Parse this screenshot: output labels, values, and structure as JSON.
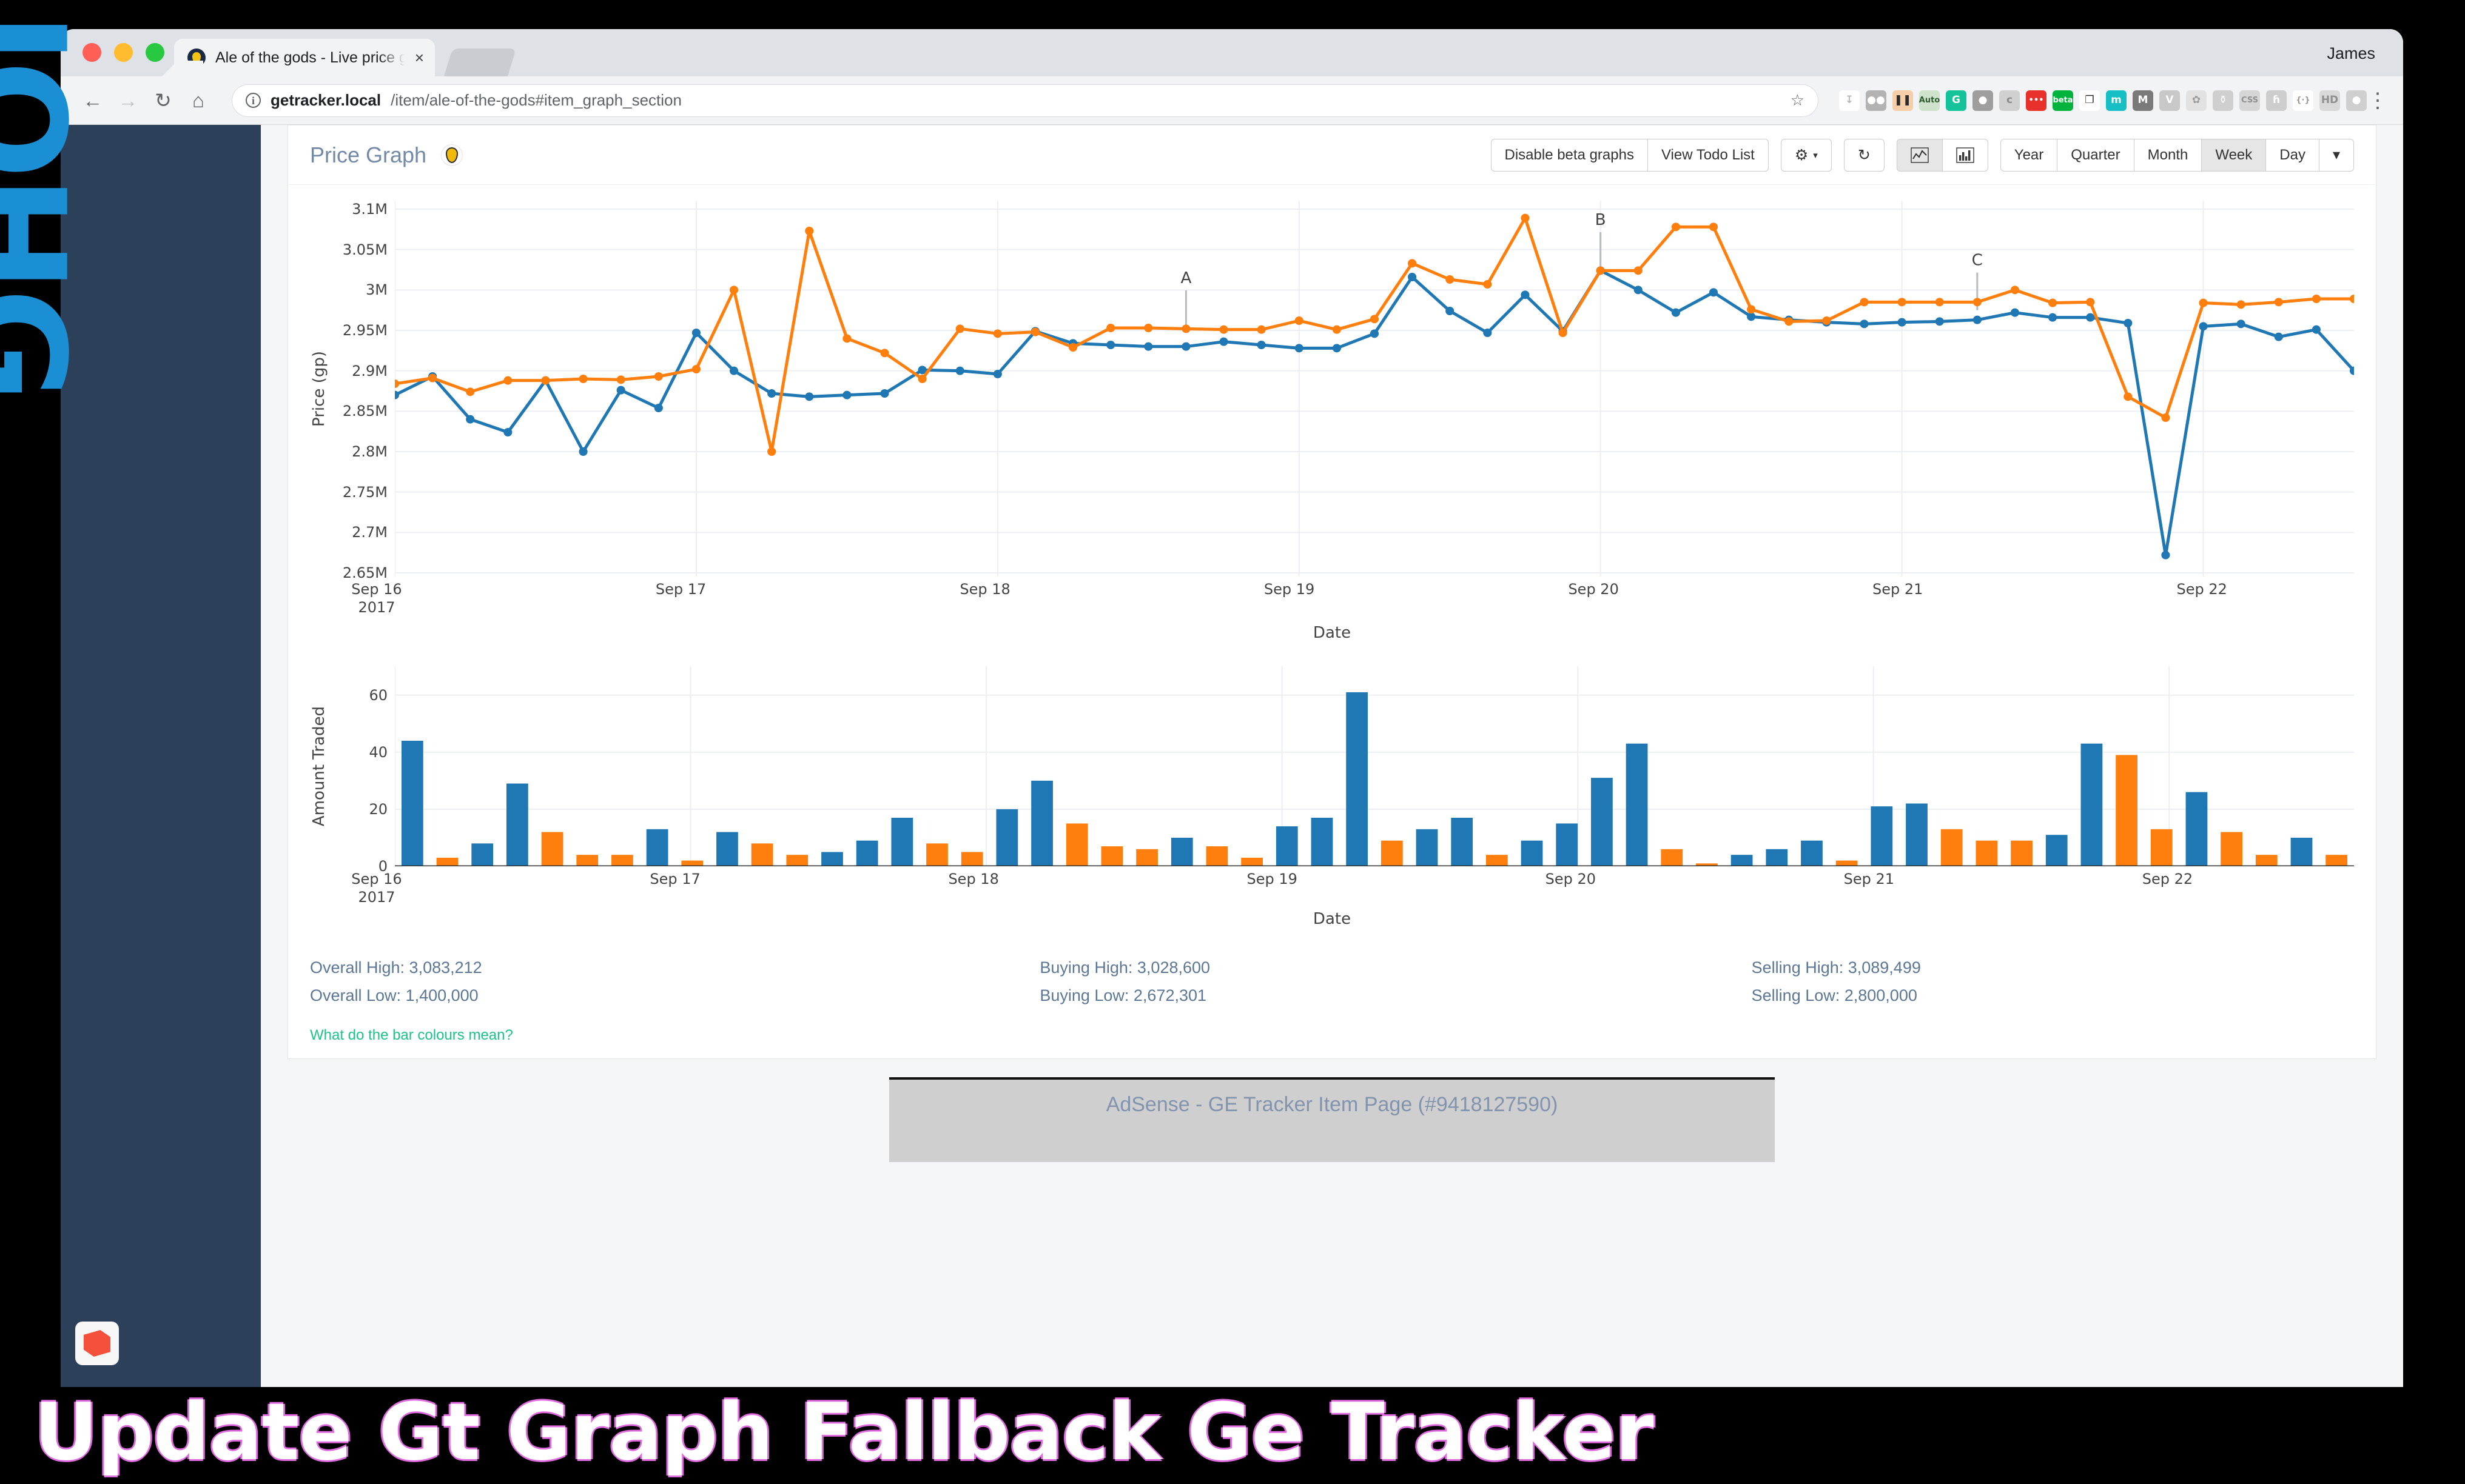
{
  "decor": {
    "left_letters": "IOHG",
    "caption": "Update Gt Graph Fallback Ge Tracker"
  },
  "browser": {
    "profile_name": "James",
    "tab": {
      "title": "Ale of the gods - Live price graph",
      "favicon": "ge-tracker-icon",
      "close": "×"
    },
    "nav": {
      "back": "←",
      "forward": "→",
      "reload": "↻",
      "home": "⌂"
    },
    "omnibox": {
      "info_icon": "i",
      "host": "getracker.local",
      "path": "/item/ale-of-the-gods#item_graph_section",
      "star": "☆"
    },
    "extensions": [
      {
        "name": "collapse-arrows-icon",
        "label": "↧",
        "bg": "#ffffff",
        "fg": "#b8b8b8"
      },
      {
        "name": "binocular-icon",
        "label": "●●",
        "bg": "#b3b3b3",
        "fg": "#ffffff"
      },
      {
        "name": "thermometer-icon",
        "label": "❚❚",
        "bg": "#f6cfa8",
        "fg": "#2b2b2b"
      },
      {
        "name": "auto-icon",
        "label": "Auto",
        "bg": "#cfe3cc",
        "fg": "#2f5d2f"
      },
      {
        "name": "grammarly-icon",
        "label": "G",
        "bg": "#15c39a",
        "fg": "#ffffff"
      },
      {
        "name": "lastpass-shield-icon",
        "label": "●",
        "bg": "#9e9e9e",
        "fg": "#ffffff"
      },
      {
        "name": "c-extension-icon",
        "label": "c",
        "bg": "#d0d0d0",
        "fg": "#8a8a8a"
      },
      {
        "name": "red-dots-icon",
        "label": "•••",
        "bg": "#e8312b",
        "fg": "#ffffff"
      },
      {
        "name": "beta-extension-icon",
        "label": "beta",
        "bg": "#00b33c",
        "fg": "#ffffff"
      },
      {
        "name": "copy-pages-icon",
        "label": "❐",
        "bg": "#ffffff",
        "fg": "#2b2b2b"
      },
      {
        "name": "m-teal-icon",
        "label": "m",
        "bg": "#16bfc4",
        "fg": "#ffffff"
      },
      {
        "name": "m-grey-icon",
        "label": "M",
        "bg": "#7a7a7a",
        "fg": "#ffffff"
      },
      {
        "name": "v-icon",
        "label": "V",
        "bg": "#c8c8c8",
        "fg": "#ffffff"
      },
      {
        "name": "flower-icon",
        "label": "✿",
        "bg": "#e2e2e2",
        "fg": "#9b9b9b"
      },
      {
        "name": "trophy-icon",
        "label": "⚱",
        "bg": "#cfcfcf",
        "fg": "#ffffff"
      },
      {
        "name": "css-icon",
        "label": "CSS",
        "bg": "#d6d6d6",
        "fg": "#8f8f8f"
      },
      {
        "name": "h-script-icon",
        "label": "ɦ",
        "bg": "#cdcdcd",
        "fg": "#ffffff"
      },
      {
        "name": "braces-icon",
        "label": "{·}",
        "bg": "#ffffff",
        "fg": "#9a9a9a"
      },
      {
        "name": "hd-icon",
        "label": "HD",
        "bg": "#d9d9d9",
        "fg": "#8f8f8f"
      },
      {
        "name": "camera-icon",
        "label": "●",
        "bg": "#cfcfcf",
        "fg": "#ffffff"
      }
    ],
    "menu_icon": "⋮"
  },
  "card": {
    "title": "Price Graph",
    "badge_icon": "ge-pin-icon",
    "buttons": {
      "disable_beta": "Disable beta graphs",
      "view_todo": "View Todo List",
      "settings_icon": "⚙",
      "refresh_icon": "↻",
      "line_chart_icon": "line-chart-icon",
      "bar_chart_icon": "bar-chart-icon",
      "caret": "▾"
    },
    "ranges": [
      "Year",
      "Quarter",
      "Month",
      "Week",
      "Day"
    ],
    "active_range": "Week"
  },
  "stats": {
    "left": [
      "Overall High: 3,083,212",
      "Overall Low: 1,400,000"
    ],
    "middle": [
      "Buying High: 3,028,600",
      "Buying Low: 2,672,301"
    ],
    "right": [
      "Selling High: 3,089,499",
      "Selling Low: 2,800,000"
    ],
    "bar_colours_link": "What do the bar colours mean?"
  },
  "ad": {
    "text": "AdSense - GE Tracker Item Page (#9418127590)"
  },
  "chart_data": [
    {
      "type": "line",
      "id": "price-graph",
      "title": "",
      "xlabel": "Date",
      "ylabel": "Price (gp)",
      "ylim": [
        2650000,
        3100000
      ],
      "yticks": [
        2650000,
        2700000,
        2750000,
        2800000,
        2850000,
        2900000,
        2950000,
        3000000,
        3050000,
        3100000
      ],
      "ytick_labels": [
        "2.65M",
        "2.7M",
        "2.75M",
        "2.8M",
        "2.85M",
        "2.9M",
        "2.95M",
        "3M",
        "3.05M",
        "3.1M"
      ],
      "xtick_positions": [
        0,
        8,
        16,
        24,
        32,
        40,
        48
      ],
      "xtick_labels": [
        "Sep 16\n2017",
        "Sep 17",
        "Sep 18",
        "Sep 19",
        "Sep 20",
        "Sep 21",
        "Sep 22"
      ],
      "grid": true,
      "n_points": 53,
      "annotations": [
        {
          "label": "A",
          "x": 21,
          "y": 2953000
        },
        {
          "label": "B",
          "x": 32,
          "y": 3025000
        },
        {
          "label": "C",
          "x": 42,
          "y": 2975000
        }
      ],
      "series": [
        {
          "name": "Buying price",
          "color": "#1f77b4",
          "values": [
            2870000,
            2893000,
            2840000,
            2824000,
            2888000,
            2800000,
            2876000,
            2854000,
            2947000,
            2900000,
            2872000,
            2868000,
            2870000,
            2872000,
            2901000,
            2900000,
            2896000,
            2949000,
            2934000,
            2932000,
            2930000,
            2930000,
            2936000,
            2932000,
            2928000,
            2928000,
            2946000,
            3016000,
            2974000,
            2947000,
            2994000,
            2949000,
            3024000,
            3000000,
            2972000,
            2997000,
            2967000,
            2963000,
            2960000,
            2958000,
            2960000,
            2961000,
            2963000,
            2972000,
            2966000,
            2966000,
            2959000,
            2672000,
            2955000,
            2958000,
            2942000,
            2951000,
            2900000
          ]
        },
        {
          "name": "Selling price",
          "color": "#ff7f0e",
          "values": [
            2884000,
            2891000,
            2874000,
            2888000,
            2888000,
            2890000,
            2889000,
            2893000,
            2902000,
            3000000,
            2800000,
            3073000,
            2940000,
            2922000,
            2890000,
            2952000,
            2946000,
            2948000,
            2929000,
            2953000,
            2953000,
            2952000,
            2951000,
            2951000,
            2962000,
            2951000,
            2964000,
            3033000,
            3013000,
            3007000,
            3089000,
            2947000,
            3024000,
            3024000,
            3078000,
            3078000,
            2976000,
            2961000,
            2962000,
            2985000,
            2985000,
            2985000,
            2985000,
            3000000,
            2984000,
            2985000,
            2868000,
            2842000,
            2984000,
            2982000,
            2985000,
            2989000,
            2989000
          ]
        }
      ]
    },
    {
      "type": "bar",
      "id": "volume-graph",
      "title": "",
      "xlabel": "Date",
      "ylabel": "Amount Traded",
      "ylim": [
        0,
        68
      ],
      "yticks": [
        0,
        20,
        40,
        60
      ],
      "ytick_labels": [
        "0",
        "20",
        "40",
        "60"
      ],
      "xtick_positions": [
        0,
        8,
        16,
        24,
        32,
        40,
        48
      ],
      "xtick_labels": [
        "Sep 16\n2017",
        "Sep 17",
        "Sep 18",
        "Sep 19",
        "Sep 20",
        "Sep 21",
        "Sep 22"
      ],
      "grid": true,
      "colors": {
        "buy": "#1f77b4",
        "sell": "#ff7f0e"
      },
      "bars": [
        {
          "v": 44,
          "c": "buy"
        },
        {
          "v": 3,
          "c": "sell"
        },
        {
          "v": 8,
          "c": "buy"
        },
        {
          "v": 29,
          "c": "buy"
        },
        {
          "v": 12,
          "c": "sell"
        },
        {
          "v": 4,
          "c": "sell"
        },
        {
          "v": 4,
          "c": "sell"
        },
        {
          "v": 13,
          "c": "buy"
        },
        {
          "v": 2,
          "c": "sell"
        },
        {
          "v": 12,
          "c": "buy"
        },
        {
          "v": 8,
          "c": "sell"
        },
        {
          "v": 4,
          "c": "sell"
        },
        {
          "v": 5,
          "c": "buy"
        },
        {
          "v": 9,
          "c": "buy"
        },
        {
          "v": 17,
          "c": "buy"
        },
        {
          "v": 8,
          "c": "sell"
        },
        {
          "v": 5,
          "c": "sell"
        },
        {
          "v": 20,
          "c": "buy"
        },
        {
          "v": 30,
          "c": "buy"
        },
        {
          "v": 15,
          "c": "sell"
        },
        {
          "v": 7,
          "c": "sell"
        },
        {
          "v": 6,
          "c": "sell"
        },
        {
          "v": 10,
          "c": "buy"
        },
        {
          "v": 7,
          "c": "sell"
        },
        {
          "v": 3,
          "c": "sell"
        },
        {
          "v": 14,
          "c": "buy"
        },
        {
          "v": 17,
          "c": "buy"
        },
        {
          "v": 61,
          "c": "buy"
        },
        {
          "v": 9,
          "c": "sell"
        },
        {
          "v": 13,
          "c": "buy"
        },
        {
          "v": 17,
          "c": "buy"
        },
        {
          "v": 4,
          "c": "sell"
        },
        {
          "v": 9,
          "c": "buy"
        },
        {
          "v": 15,
          "c": "buy"
        },
        {
          "v": 31,
          "c": "buy"
        },
        {
          "v": 43,
          "c": "buy"
        },
        {
          "v": 6,
          "c": "sell"
        },
        {
          "v": 1,
          "c": "sell"
        },
        {
          "v": 4,
          "c": "buy"
        },
        {
          "v": 6,
          "c": "buy"
        },
        {
          "v": 9,
          "c": "buy"
        },
        {
          "v": 2,
          "c": "sell"
        },
        {
          "v": 21,
          "c": "buy"
        },
        {
          "v": 22,
          "c": "buy"
        },
        {
          "v": 13,
          "c": "sell"
        },
        {
          "v": 9,
          "c": "sell"
        },
        {
          "v": 9,
          "c": "sell"
        },
        {
          "v": 11,
          "c": "buy"
        },
        {
          "v": 43,
          "c": "buy"
        },
        {
          "v": 39,
          "c": "sell"
        },
        {
          "v": 13,
          "c": "sell"
        },
        {
          "v": 26,
          "c": "buy"
        },
        {
          "v": 12,
          "c": "sell"
        },
        {
          "v": 4,
          "c": "sell"
        },
        {
          "v": 10,
          "c": "buy"
        },
        {
          "v": 4,
          "c": "sell"
        }
      ]
    }
  ]
}
